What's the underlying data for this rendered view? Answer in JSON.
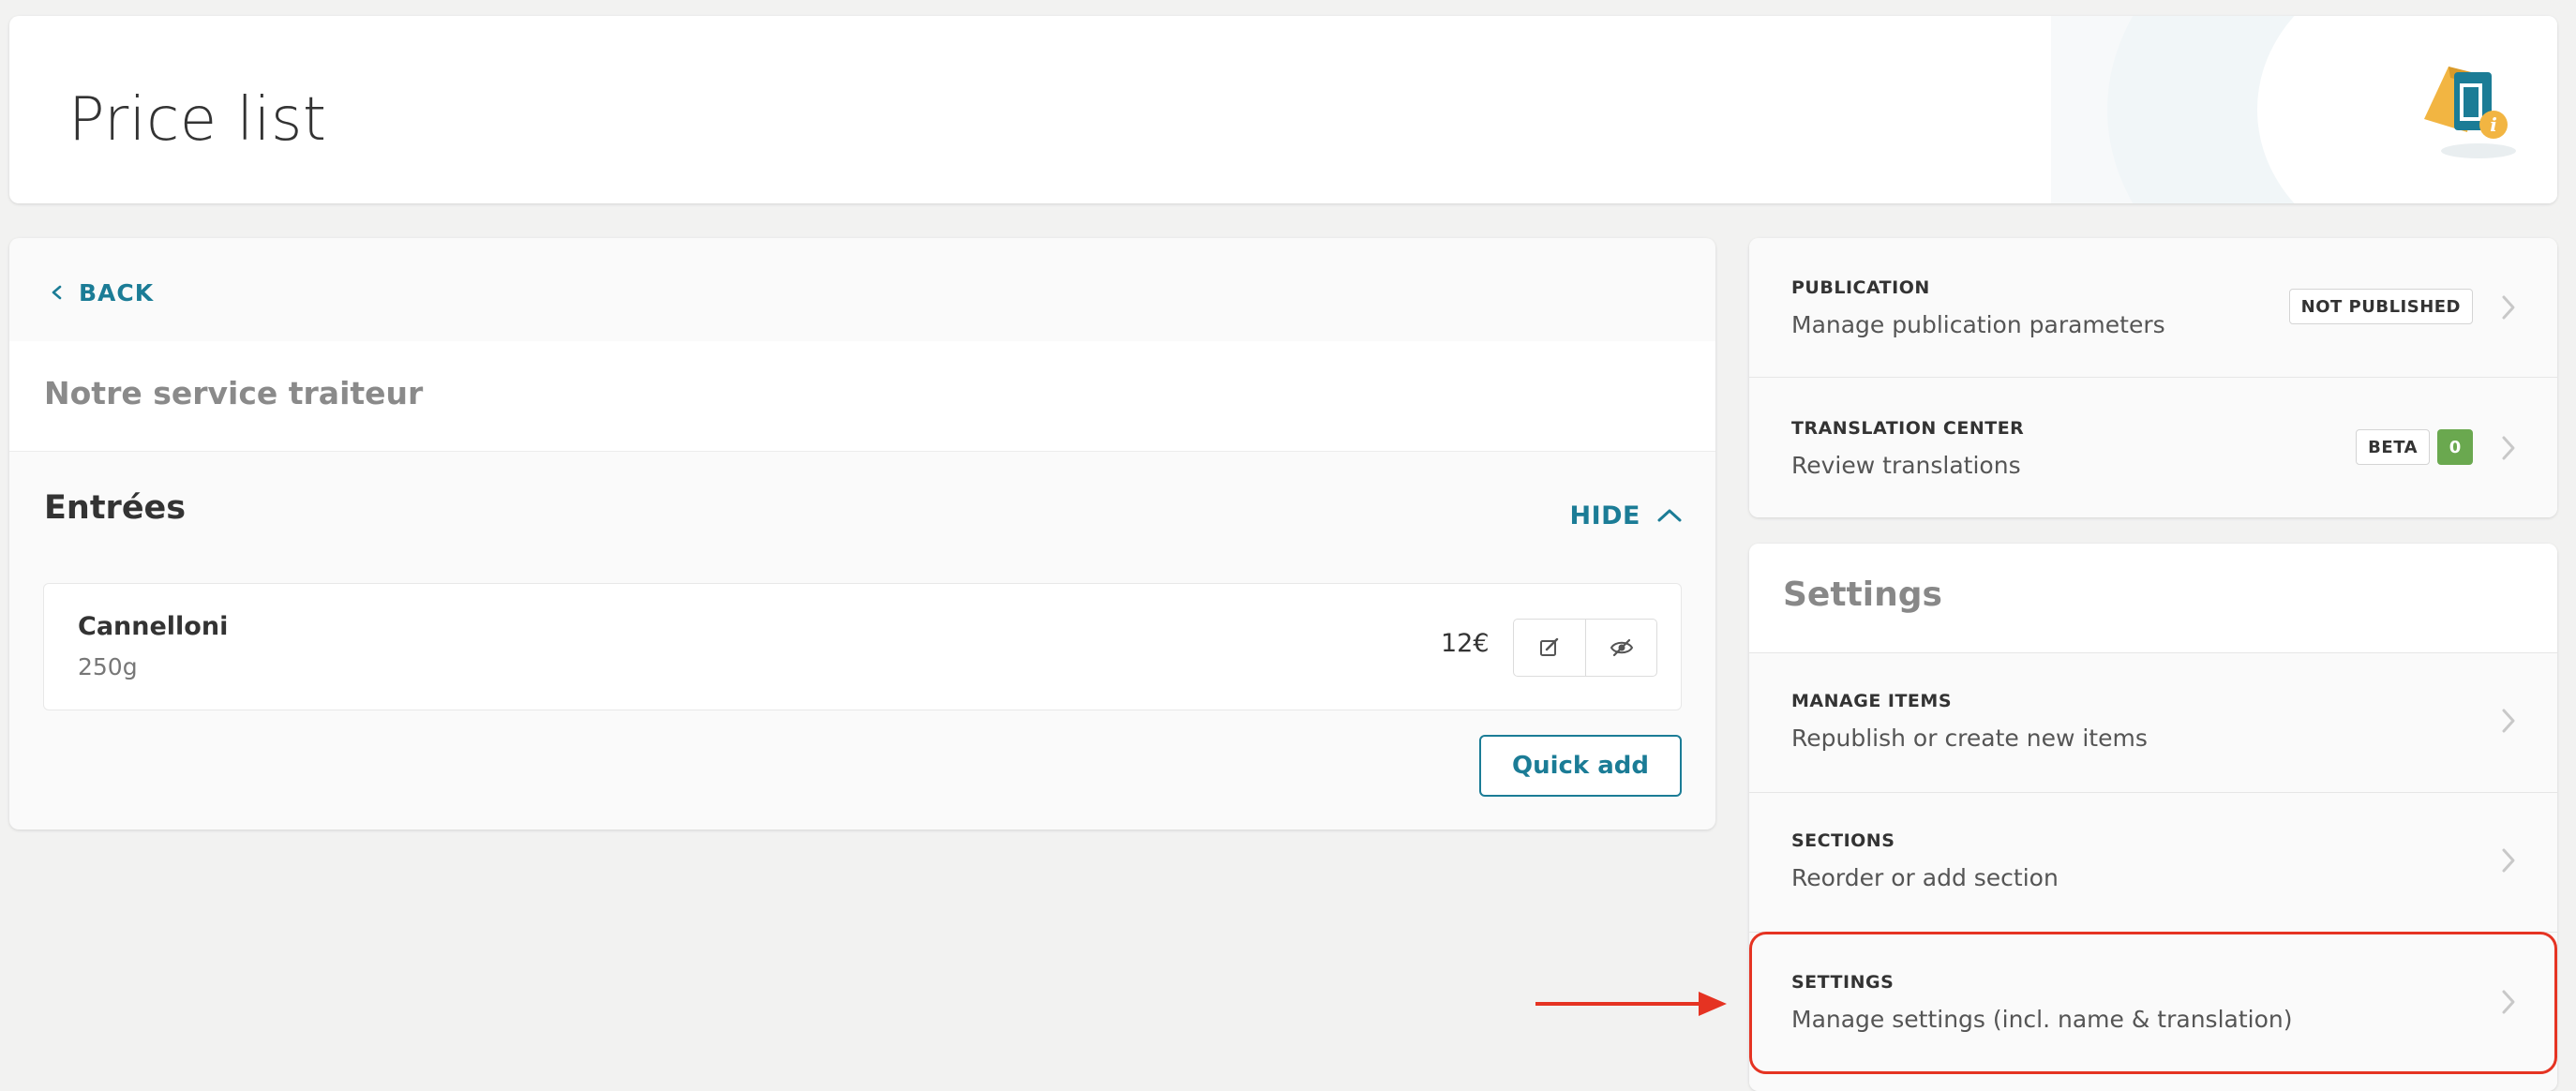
{
  "header": {
    "title": "Price list"
  },
  "left_panel": {
    "back_label": "BACK",
    "menu_name": "Notre service traiteur",
    "section": {
      "title": "Entrées",
      "hide_label": "HIDE",
      "items": [
        {
          "name": "Cannelloni",
          "description": "250g",
          "price": "12€"
        }
      ],
      "quick_add_label": "Quick add"
    }
  },
  "publication_card": {
    "publication": {
      "label": "PUBLICATION",
      "sub": "Manage publication parameters",
      "badge": "NOT PUBLISHED"
    },
    "translation": {
      "label": "TRANSLATION CENTER",
      "sub": "Review translations",
      "badge": "BETA",
      "count": "0"
    }
  },
  "settings_card": {
    "title": "Settings",
    "rows": [
      {
        "label": "MANAGE ITEMS",
        "sub": "Republish or create new items"
      },
      {
        "label": "SECTIONS",
        "sub": "Reorder or add section"
      },
      {
        "label": "SETTINGS",
        "sub": "Manage settings (incl. name & translation)"
      }
    ]
  },
  "icons": {
    "back": "chevron-left-icon",
    "hide": "chevron-up-icon",
    "edit": "edit-icon",
    "visibility": "eye-off-icon",
    "row_chevron": "chevron-right-icon",
    "logo": "price-tag-info-icon"
  },
  "colors": {
    "accent": "#1b7c96",
    "highlight": "#e53322",
    "count_badge": "#6aa84f",
    "background": "#f2f2f1"
  }
}
